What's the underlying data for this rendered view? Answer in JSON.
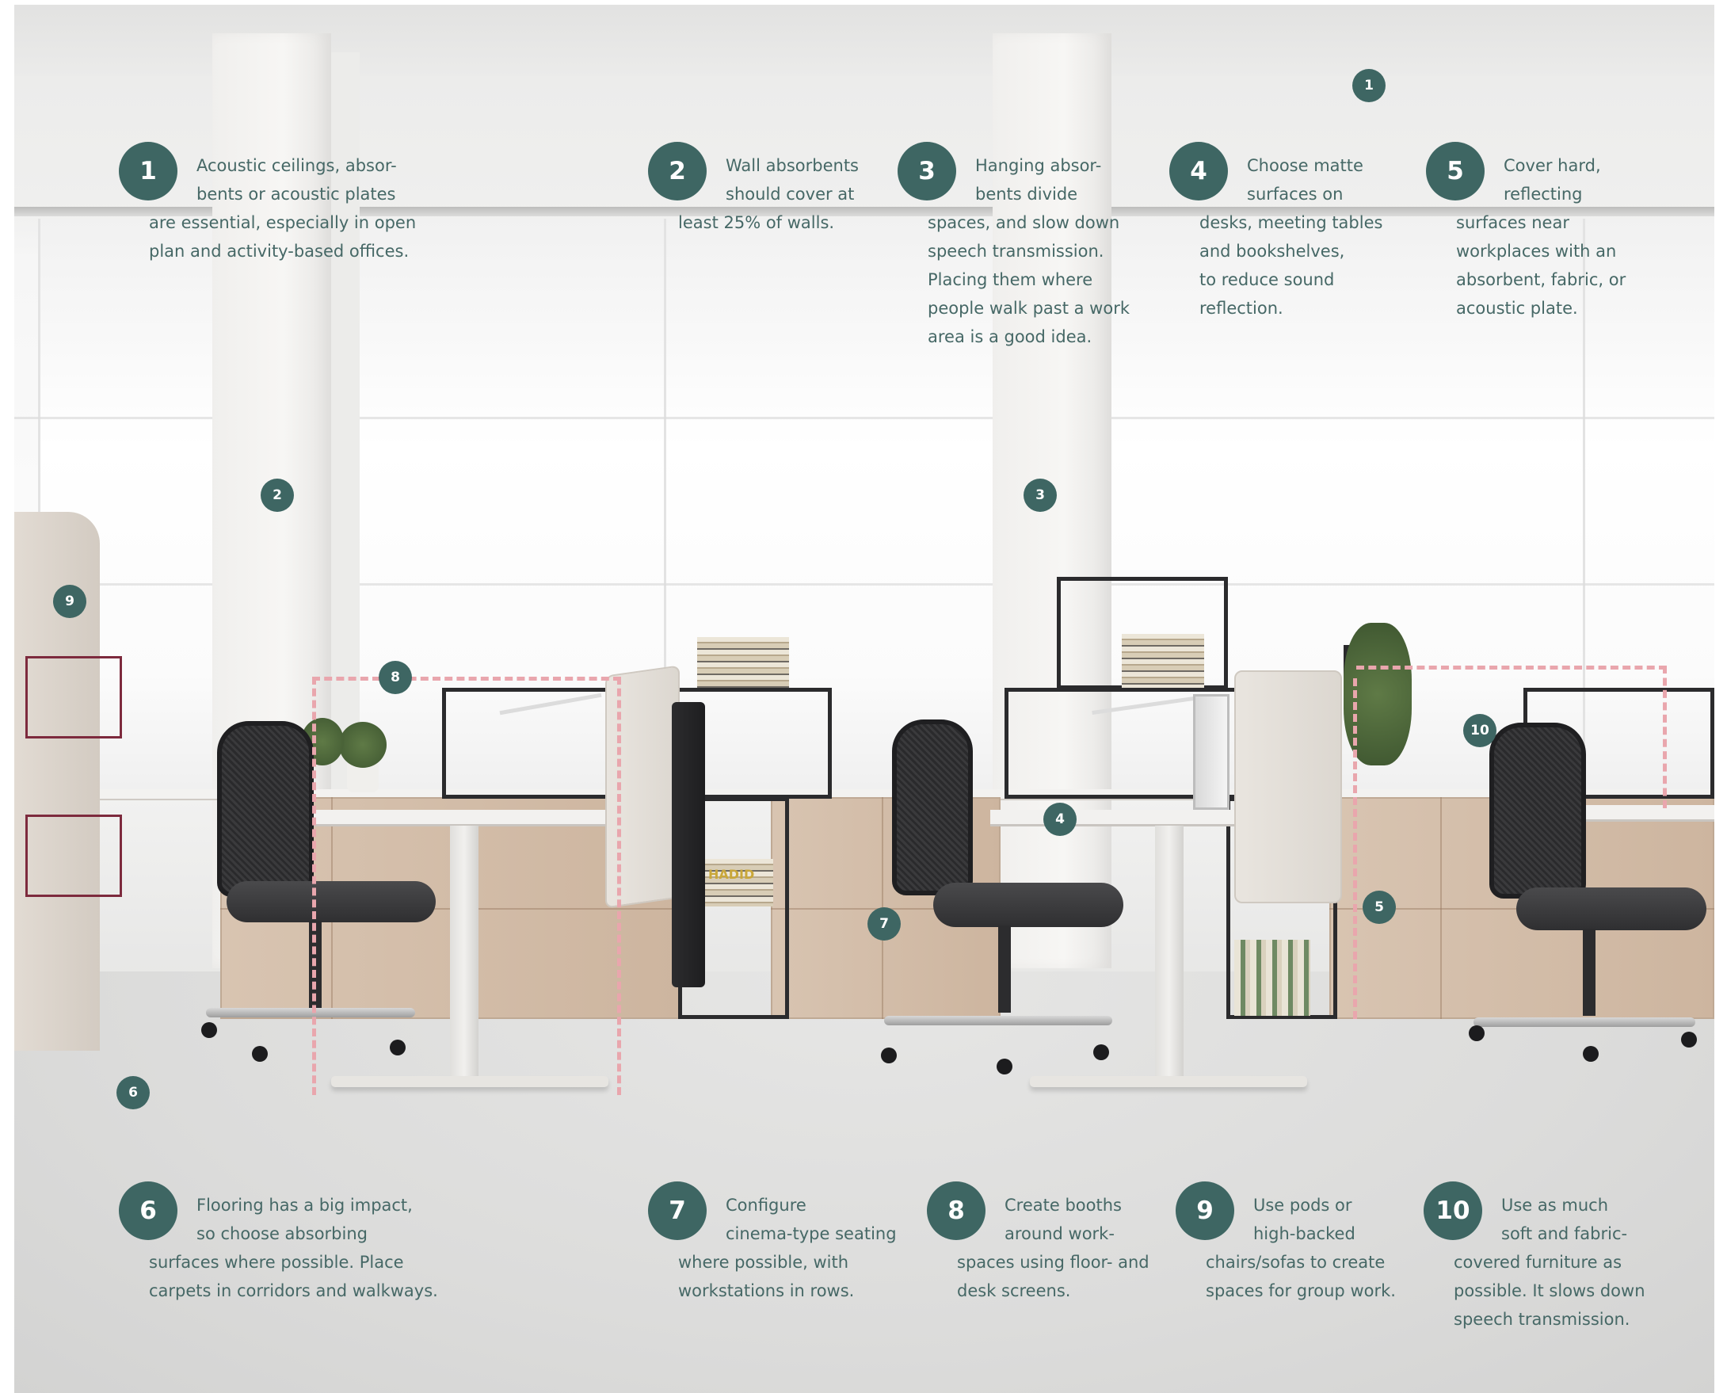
{
  "callouts": [
    {
      "number": "1",
      "lines": [
        "Acoustic ceilings, absor-",
        "bents or acoustic plates",
        "are essential, especially in open",
        "plan and activity-based offices."
      ]
    },
    {
      "number": "2",
      "lines": [
        "Wall absorbents",
        "should cover at",
        "least 25% of walls."
      ]
    },
    {
      "number": "3",
      "lines": [
        "Hanging absor-",
        "bents divide",
        "spaces, and slow down",
        "speech transmission.",
        "Placing them where",
        "people walk past a work",
        "area is a good idea."
      ]
    },
    {
      "number": "4",
      "lines": [
        "Choose matte",
        "surfaces on",
        "desks, meeting tables",
        "and bookshelves,",
        "to reduce sound",
        "reflection."
      ]
    },
    {
      "number": "5",
      "lines": [
        "Cover hard,",
        "reflecting",
        "surfaces near",
        "workplaces with an",
        "absorbent, fabric, or",
        "acoustic plate."
      ]
    },
    {
      "number": "6",
      "lines": [
        "Flooring has a big impact,",
        "so choose absorbing",
        "surfaces where possible. Place",
        "carpets in corridors and walkways."
      ]
    },
    {
      "number": "7",
      "lines": [
        "Configure",
        "cinema-type seating",
        "where possible, with",
        "workstations in rows."
      ]
    },
    {
      "number": "8",
      "lines": [
        "Create booths",
        "around work-",
        "spaces using floor- and",
        "desk screens."
      ]
    },
    {
      "number": "9",
      "lines": [
        "Use pods or",
        "high-backed",
        "chairs/sofas to create",
        "spaces for group work."
      ]
    },
    {
      "number": "10",
      "lines": [
        "Use as much",
        "soft and fabric-",
        "covered furniture as",
        "possible. It slows down",
        "speech transmission."
      ]
    }
  ],
  "scene_markers": [
    "1",
    "2",
    "3",
    "4",
    "5",
    "6",
    "7",
    "8",
    "9",
    "10"
  ],
  "book_spine_text": "HADID",
  "colors": {
    "marker": "#3e6663",
    "text": "#466866",
    "dashed_zone": "#e9a6ad"
  }
}
